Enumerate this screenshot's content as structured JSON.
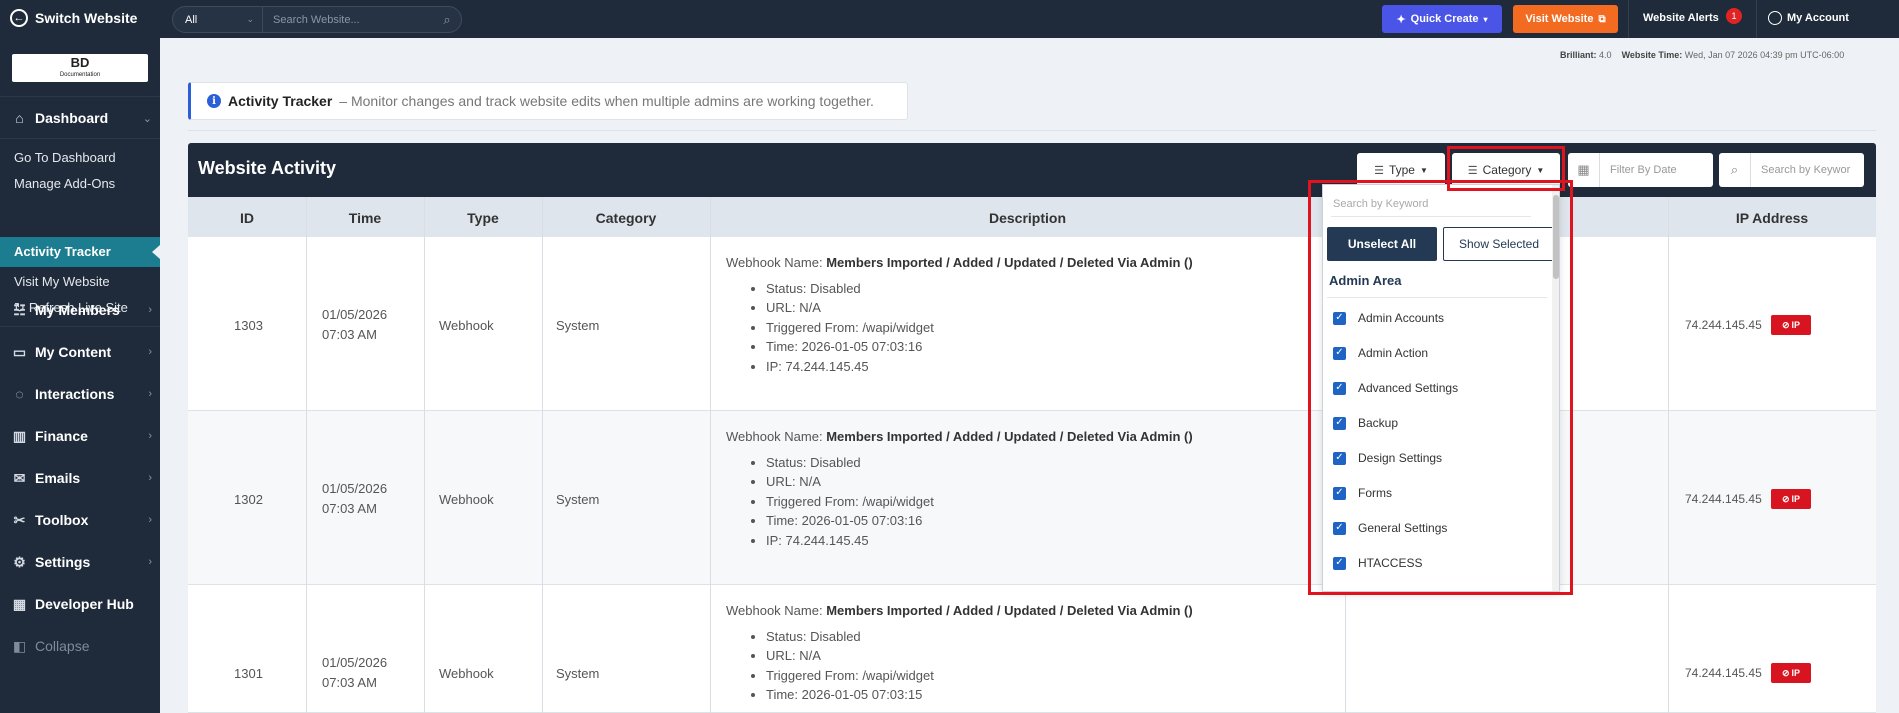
{
  "topbar": {
    "switch_label": "Switch Website",
    "search_scope": "All",
    "search_placeholder": "Search Website...",
    "quick_create": "Quick Create",
    "visit_website": "Visit Website",
    "alerts_label": "Website Alerts",
    "alerts_count": "1",
    "account_label": "My Account"
  },
  "logo": {
    "text": "BD",
    "subtext": "Documentation"
  },
  "sidebar": {
    "dashboard": "Dashboard",
    "sub": [
      "Go To Dashboard",
      "Manage Add-Ons",
      "Activity Tracker",
      "Visit My Website",
      "Refresh Live Site"
    ],
    "items": [
      "My Members",
      "My Content",
      "Interactions",
      "Finance",
      "Emails",
      "Toolbox",
      "Settings",
      "Developer Hub",
      "Collapse"
    ]
  },
  "meta": {
    "brilliant_label": "Brilliant:",
    "brilliant_value": "4.0",
    "time_label": "Website Time:",
    "time_value": "Wed, Jan 07 2026 04:39 pm UTC-06:00"
  },
  "info": {
    "title": "Activity Tracker",
    "text": "– Monitor changes and track website edits when multiple admins are working together."
  },
  "panel": {
    "title": "Website Activity",
    "type_btn": "Type",
    "category_btn": "Category",
    "date_placeholder": "Filter By Date",
    "keyword_placeholder": "Search by Keywor"
  },
  "table": {
    "columns": [
      "ID",
      "Time",
      "Type",
      "Category",
      "Description",
      "IP Address"
    ],
    "ip_button": "IP",
    "rows": [
      {
        "id": "1303",
        "date": "01/05/2026",
        "time": "07:03 AM",
        "type": "Webhook",
        "category": "System",
        "name_label": "Webhook Name:",
        "name": "Members Imported / Added / Updated / Deleted Via Admin ()",
        "details": [
          "Status: Disabled",
          "URL: N/A",
          "Triggered From: /wapi/widget",
          "Time: 2026-01-05 07:03:16",
          "IP: 74.244.145.45"
        ],
        "ip": "74.244.145.45"
      },
      {
        "id": "1302",
        "date": "01/05/2026",
        "time": "07:03 AM",
        "type": "Webhook",
        "category": "System",
        "name_label": "Webhook Name:",
        "name": "Members Imported / Added / Updated / Deleted Via Admin ()",
        "details": [
          "Status: Disabled",
          "URL: N/A",
          "Triggered From: /wapi/widget",
          "Time: 2026-01-05 07:03:16",
          "IP: 74.244.145.45"
        ],
        "ip": "74.244.145.45"
      },
      {
        "id": "1301",
        "date": "01/05/2026",
        "time": "07:03 AM",
        "type": "Webhook",
        "category": "System",
        "name_label": "Webhook Name:",
        "name": "Members Imported / Added / Updated / Deleted Via Admin ()",
        "details": [
          "Status: Disabled",
          "URL: N/A",
          "Triggered From: /wapi/widget",
          "Time: 2026-01-05 07:03:15"
        ],
        "ip": "74.244.145.45"
      }
    ]
  },
  "dropdown": {
    "search_placeholder": "Search by Keyword",
    "unselect_all": "Unselect All",
    "show_selected": "Show Selected",
    "group": "Admin Area",
    "items": [
      "Admin Accounts",
      "Admin Action",
      "Advanced Settings",
      "Backup",
      "Design Settings",
      "Forms",
      "General Settings",
      "HTACCESS"
    ]
  },
  "colors": {
    "navy": "#1f2b3a",
    "teal_active": "#1b7d8f",
    "quick_create": "#4a55e8",
    "visit_website": "#f26b21",
    "highlight": "#e0141e",
    "ip_button": "#d7141f"
  }
}
